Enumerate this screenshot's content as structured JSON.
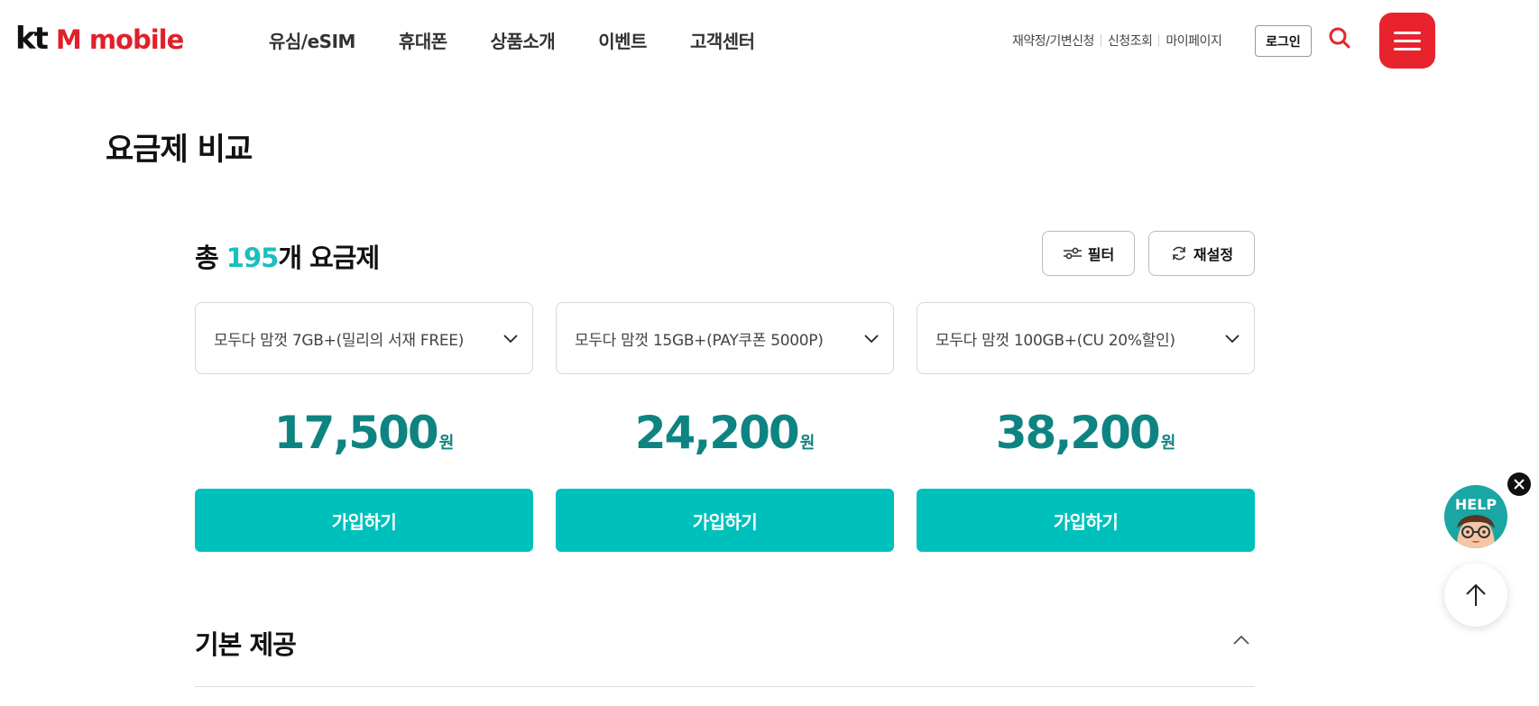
{
  "header": {
    "logo_kt": "kt",
    "logo_m": "M mobile",
    "nav": [
      "유심/eSIM",
      "휴대폰",
      "상품소개",
      "이벤트",
      "고객센터"
    ],
    "util": [
      "재약정/기변신청",
      "신청조회",
      "마이페이지"
    ],
    "login_label": "로그인"
  },
  "page": {
    "title": "요금제 비교"
  },
  "summary": {
    "prefix": "총 ",
    "count": "195",
    "suffix": "개 요금제",
    "filter_label": "필터",
    "reset_label": "재설정"
  },
  "plans": [
    {
      "name": "모두다 맘껏 7GB+(밀리의 서재 FREE)",
      "price": "17,500",
      "unit": "원",
      "join_label": "가입하기"
    },
    {
      "name": "모두다 맘껏 15GB+(PAY쿠폰 5000P)",
      "price": "24,200",
      "unit": "원",
      "join_label": "가입하기"
    },
    {
      "name": "모두다 맘껏 100GB+(CU 20%할인)",
      "price": "38,200",
      "unit": "원",
      "join_label": "가입하기"
    }
  ],
  "section": {
    "title": "기본 제공"
  },
  "floating": {
    "help_label": "HELP"
  },
  "colors": {
    "brand_red": "#e8232d",
    "accent_teal": "#00c0bb",
    "price_teal": "#0e8482"
  },
  "icons": [
    "search-icon",
    "menu-icon",
    "filter-icon",
    "refresh-icon",
    "chevron-down-icon",
    "chevron-up-icon",
    "close-icon",
    "arrow-up-icon"
  ]
}
